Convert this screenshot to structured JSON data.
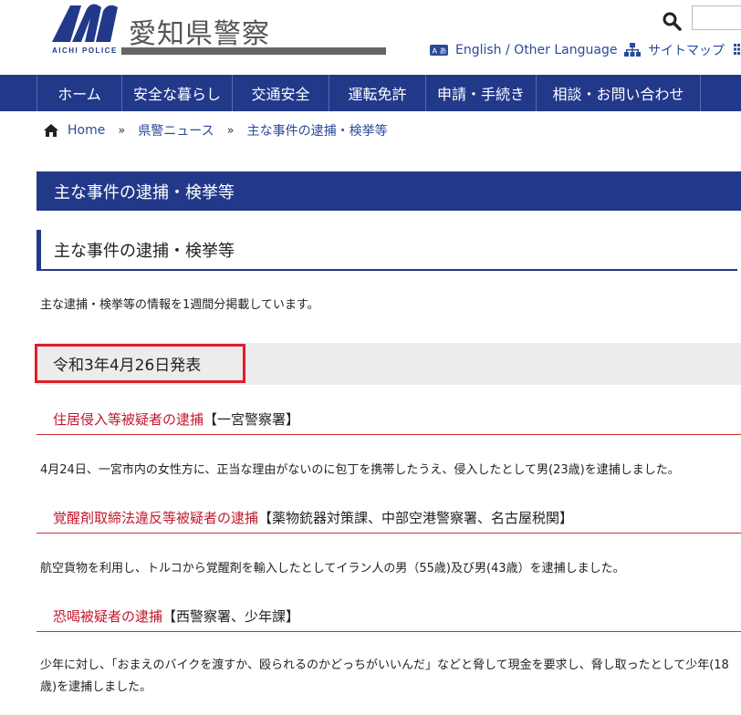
{
  "header": {
    "logo_text_ja": "愛知県警察",
    "logo_text_en": "AICHI POLICE",
    "language_link": "English / Other Language",
    "sitemap_link": "サイトマップ"
  },
  "nav": {
    "items": [
      "ホーム",
      "安全な暮らし",
      "交通安全",
      "運転免許",
      "申請・手続き",
      "相談・お問い合わせ"
    ]
  },
  "breadcrumb": {
    "home": "Home",
    "sep": "»",
    "level1": "県警ニュース",
    "level2": "主な事件の逮捕・検挙等"
  },
  "page_title": "主な事件の逮捕・検挙等",
  "section_title": "主な事件の逮捕・検挙等",
  "intro": "主な逮捕・検挙等の情報を1週間分掲載しています。",
  "date_heading": "令和3年4月26日発表",
  "cases": [
    {
      "title": "住居侵入等被疑者の逮捕",
      "dept": "【一宮警察署】",
      "body": "4月24日、一宮市内の女性方に、正当な理由がないのに包丁を携帯したうえ、侵入したとして男(23歳)を逮捕しました。"
    },
    {
      "title": "覚醒剤取締法違反等被疑者の逮捕",
      "dept": "【薬物銃器対策課、中部空港警察署、名古屋税関】",
      "body": "航空貨物を利用し、トルコから覚醒剤を輸入したとしてイラン人の男（55歳)及び男(43歳）を逮捕しました。"
    },
    {
      "title": "恐喝被疑者の逮捕",
      "dept": "【西警察署、少年課】",
      "body": "少年に対し、「おまえのバイクを渡すか、殴られるのかどっちがいいんだ」などと脅して現金を要求し、脅し取ったとして少年(18歳)を逮捕しました。"
    }
  ],
  "colors": {
    "brand_blue": "#22398a",
    "link_red": "#c0182d",
    "highlight_red": "#e11d2a"
  }
}
